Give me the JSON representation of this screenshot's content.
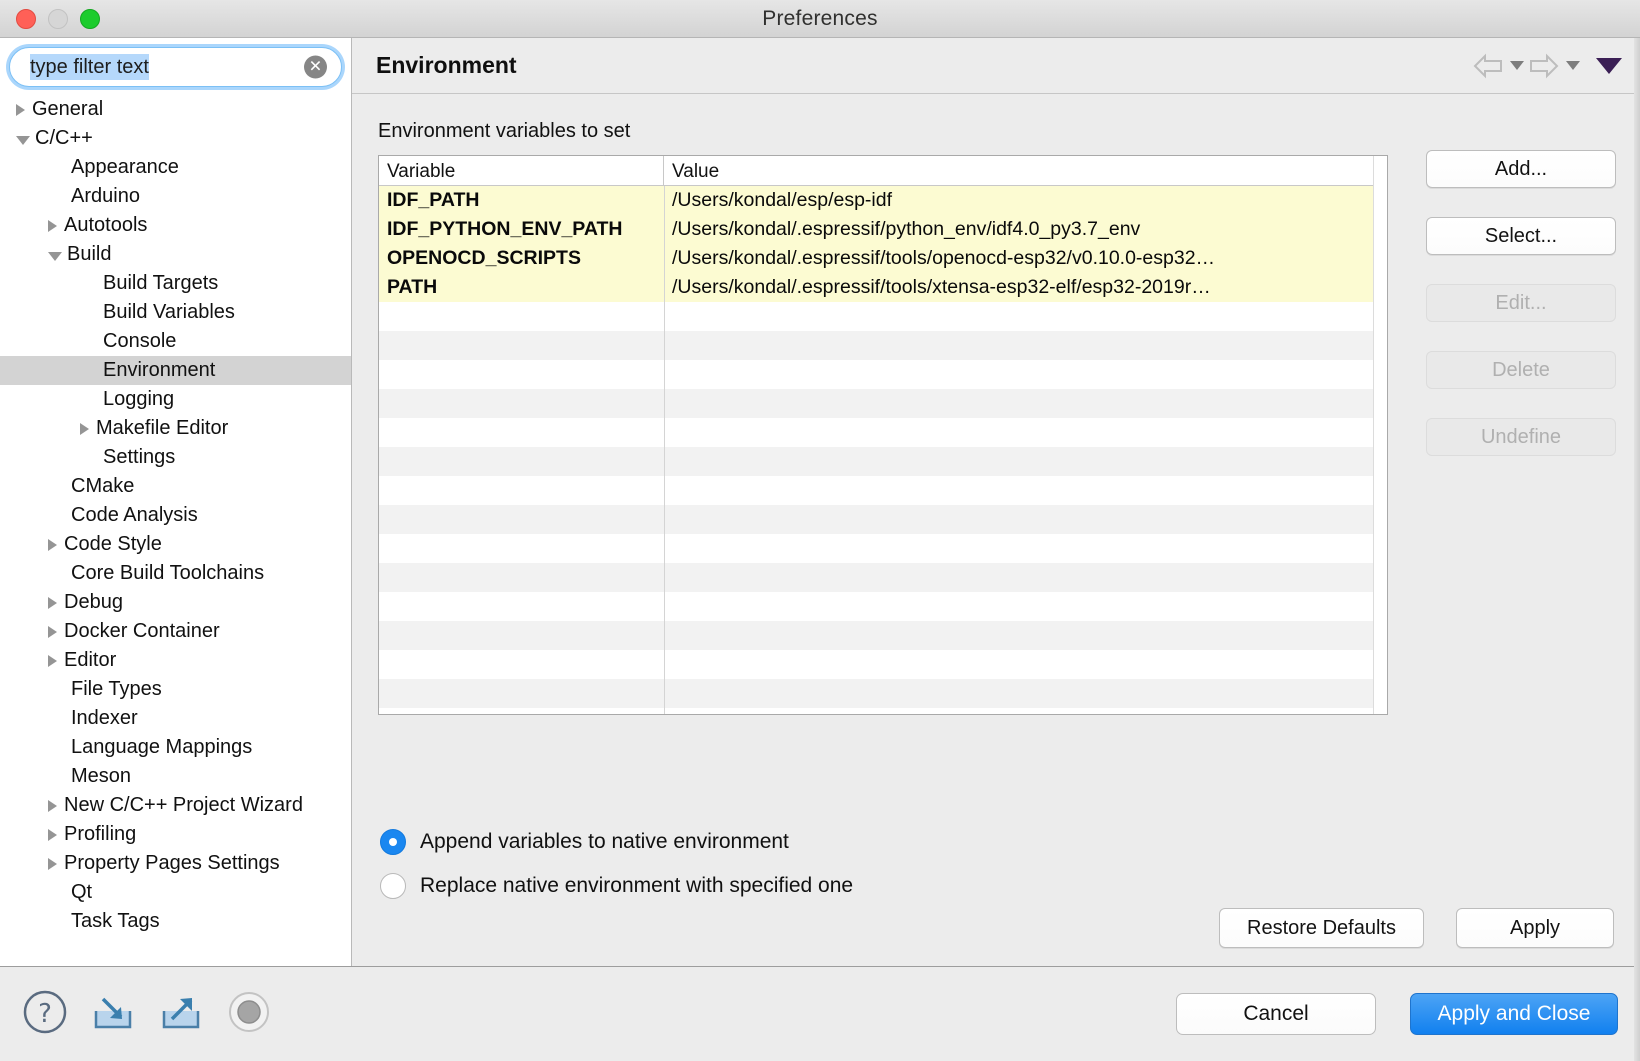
{
  "window": {
    "title": "Preferences",
    "traffic_lights": [
      "close",
      "minimize",
      "zoom"
    ]
  },
  "sidebar": {
    "filter": {
      "value": "type filter text",
      "placeholder": "type filter text",
      "clear_icon": "clear-icon",
      "selected": true
    },
    "items": [
      {
        "label": "General",
        "depth": 0,
        "toggle": "collapsed",
        "selected": false
      },
      {
        "label": "C/C++",
        "depth": 0,
        "toggle": "expanded",
        "selected": false
      },
      {
        "label": "Appearance",
        "depth": 1,
        "toggle": "leaf",
        "selected": false
      },
      {
        "label": "Arduino",
        "depth": 1,
        "toggle": "leaf",
        "selected": false
      },
      {
        "label": "Autotools",
        "depth": 1,
        "toggle": "collapsed",
        "selected": false
      },
      {
        "label": "Build",
        "depth": 1,
        "toggle": "expanded",
        "selected": false
      },
      {
        "label": "Build Targets",
        "depth": 2,
        "toggle": "leaf",
        "selected": false
      },
      {
        "label": "Build Variables",
        "depth": 2,
        "toggle": "leaf",
        "selected": false
      },
      {
        "label": "Console",
        "depth": 2,
        "toggle": "leaf",
        "selected": false
      },
      {
        "label": "Environment",
        "depth": 2,
        "toggle": "leaf",
        "selected": true
      },
      {
        "label": "Logging",
        "depth": 2,
        "toggle": "leaf",
        "selected": false
      },
      {
        "label": "Makefile Editor",
        "depth": 2,
        "toggle": "collapsed",
        "selected": false
      },
      {
        "label": "Settings",
        "depth": 2,
        "toggle": "leaf",
        "selected": false
      },
      {
        "label": "CMake",
        "depth": 1,
        "toggle": "leaf",
        "selected": false
      },
      {
        "label": "Code Analysis",
        "depth": 1,
        "toggle": "leaf",
        "selected": false
      },
      {
        "label": "Code Style",
        "depth": 1,
        "toggle": "collapsed",
        "selected": false
      },
      {
        "label": "Core Build Toolchains",
        "depth": 1,
        "toggle": "leaf",
        "selected": false
      },
      {
        "label": "Debug",
        "depth": 1,
        "toggle": "collapsed",
        "selected": false
      },
      {
        "label": "Docker Container",
        "depth": 1,
        "toggle": "collapsed",
        "selected": false
      },
      {
        "label": "Editor",
        "depth": 1,
        "toggle": "collapsed",
        "selected": false
      },
      {
        "label": "File Types",
        "depth": 1,
        "toggle": "leaf",
        "selected": false
      },
      {
        "label": "Indexer",
        "depth": 1,
        "toggle": "leaf",
        "selected": false
      },
      {
        "label": "Language Mappings",
        "depth": 1,
        "toggle": "leaf",
        "selected": false
      },
      {
        "label": "Meson",
        "depth": 1,
        "toggle": "leaf",
        "selected": false
      },
      {
        "label": "New C/C++ Project Wizard",
        "depth": 1,
        "toggle": "collapsed",
        "selected": false
      },
      {
        "label": "Profiling",
        "depth": 1,
        "toggle": "collapsed",
        "selected": false
      },
      {
        "label": "Property Pages Settings",
        "depth": 1,
        "toggle": "collapsed",
        "selected": false
      },
      {
        "label": "Qt",
        "depth": 1,
        "toggle": "leaf",
        "selected": false
      },
      {
        "label": "Task Tags",
        "depth": 1,
        "toggle": "leaf",
        "selected": false
      }
    ]
  },
  "page": {
    "title": "Environment",
    "nav": {
      "back_icon": "back-arrow-icon",
      "forward_icon": "forward-arrow-icon",
      "menu_icon": "view-menu-caret-icon"
    },
    "section_label": "Environment variables to set",
    "table": {
      "columns": [
        "Variable",
        "Value"
      ],
      "rows": [
        {
          "variable": "IDF_PATH",
          "value": "/Users/kondal/esp/esp-idf"
        },
        {
          "variable": "IDF_PYTHON_ENV_PATH",
          "value": "/Users/kondal/.espressif/python_env/idf4.0_py3.7_env"
        },
        {
          "variable": "OPENOCD_SCRIPTS",
          "value": "/Users/kondal/.espressif/tools/openocd-esp32/v0.10.0-esp32…"
        },
        {
          "variable": "PATH",
          "value": "/Users/kondal/.espressif/tools/xtensa-esp32-elf/esp32-2019r…"
        }
      ]
    },
    "side_buttons": [
      {
        "label": "Add...",
        "enabled": true
      },
      {
        "label": "Select...",
        "enabled": true
      },
      {
        "label": "Edit...",
        "enabled": false
      },
      {
        "label": "Delete",
        "enabled": false
      },
      {
        "label": "Undefine",
        "enabled": false
      }
    ],
    "radio_options": [
      {
        "label": "Append variables to native environment",
        "selected": true
      },
      {
        "label": "Replace native environment with specified one",
        "selected": false
      }
    ],
    "restore_defaults_label": "Restore Defaults",
    "apply_label": "Apply"
  },
  "footer": {
    "icons": [
      {
        "name": "help-icon"
      },
      {
        "name": "import-icon"
      },
      {
        "name": "export-icon"
      },
      {
        "name": "record-icon"
      }
    ],
    "cancel_label": "Cancel",
    "apply_and_close_label": "Apply and Close"
  },
  "colors": {
    "accent": "#1180ef",
    "selection": "#b5d8fb",
    "row_highlight": "#fcfbd2",
    "tree_selection": "#d3d3d3",
    "window_bg": "#ececec"
  }
}
